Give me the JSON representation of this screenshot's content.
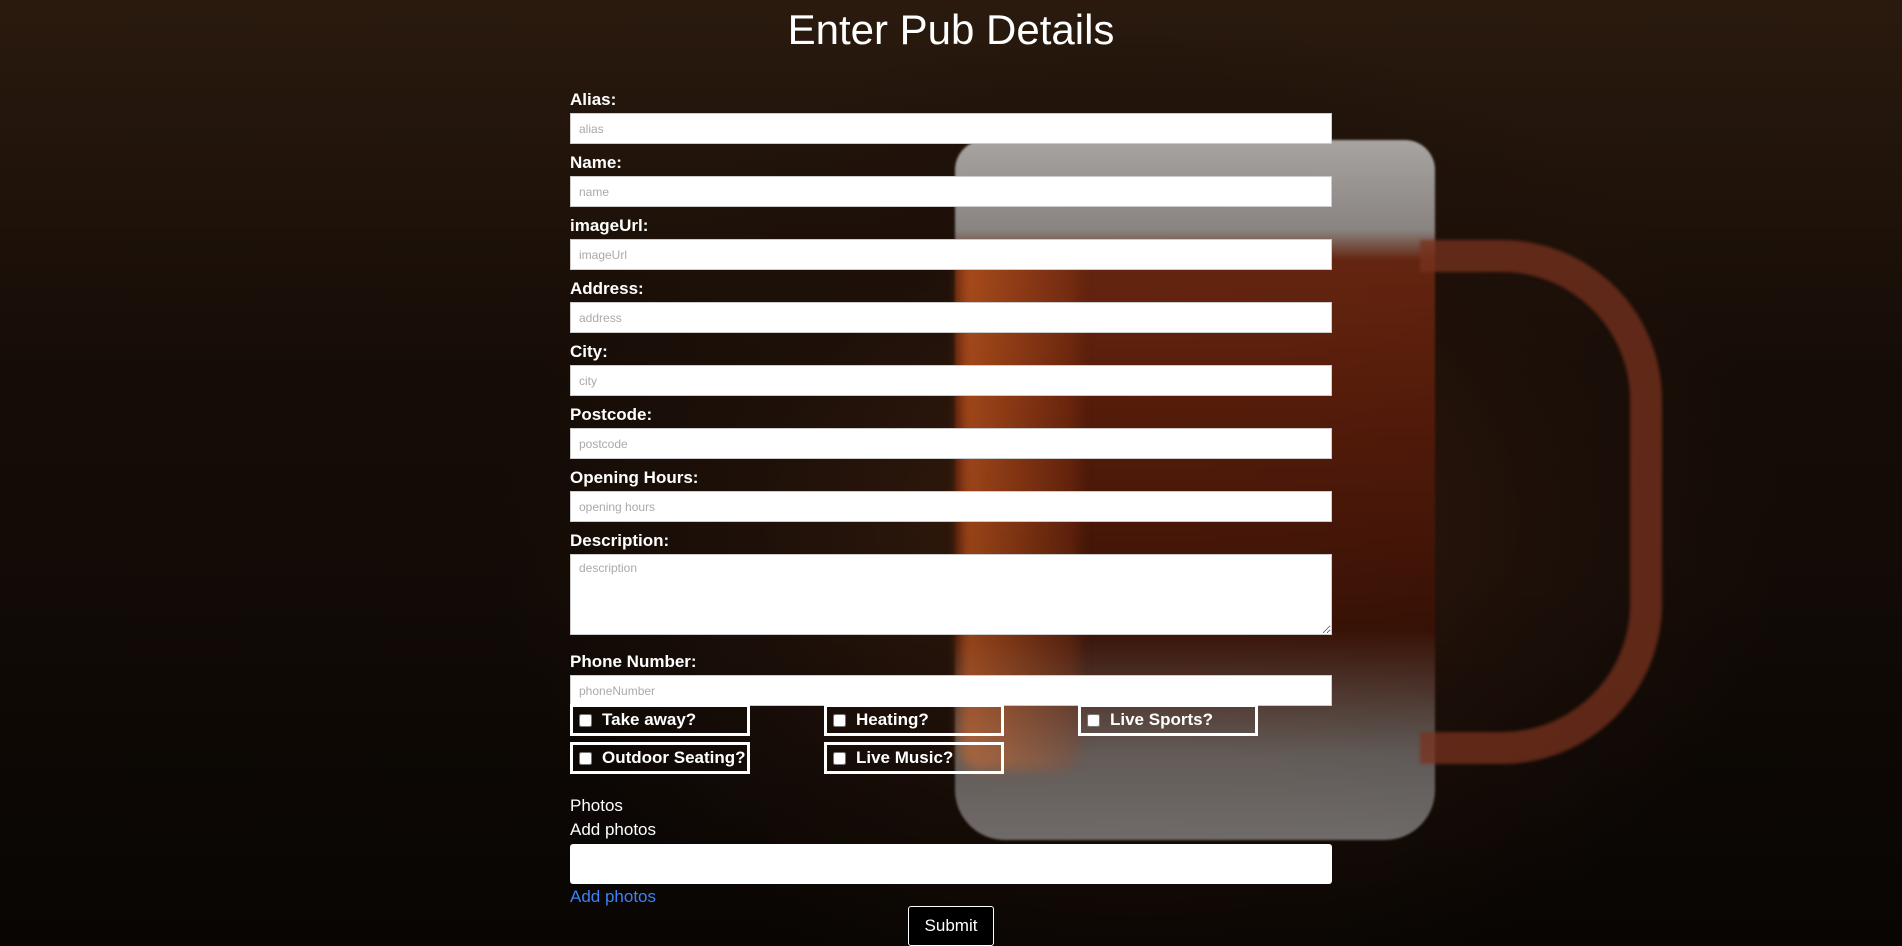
{
  "page": {
    "title": "Enter Pub Details"
  },
  "fields": [
    {
      "label": "Alias:",
      "placeholder": "alias"
    },
    {
      "label": "Name:",
      "placeholder": "name"
    },
    {
      "label": "imageUrl:",
      "placeholder": "imageUrl"
    },
    {
      "label": "Address:",
      "placeholder": "address"
    },
    {
      "label": "City:",
      "placeholder": "city"
    },
    {
      "label": "Postcode:",
      "placeholder": "postcode"
    },
    {
      "label": "Opening Hours:",
      "placeholder": "opening hours"
    },
    {
      "label": "Description:",
      "placeholder": "description"
    },
    {
      "label": "Phone Number:",
      "placeholder": "phoneNumber"
    }
  ],
  "checkboxes": [
    {
      "label": "Take away?",
      "checked": false
    },
    {
      "label": "Heating?",
      "checked": false
    },
    {
      "label": "Live Sports?",
      "checked": false
    },
    {
      "label": "Outdoor Seating?",
      "checked": false
    },
    {
      "label": "Live Music?",
      "checked": false
    }
  ],
  "photos": {
    "heading": "Photos",
    "label": "Add photos",
    "link": "Add photos"
  },
  "submit_label": "Submit",
  "colors": {
    "link": "#3b82f6",
    "background": "#120b06"
  }
}
